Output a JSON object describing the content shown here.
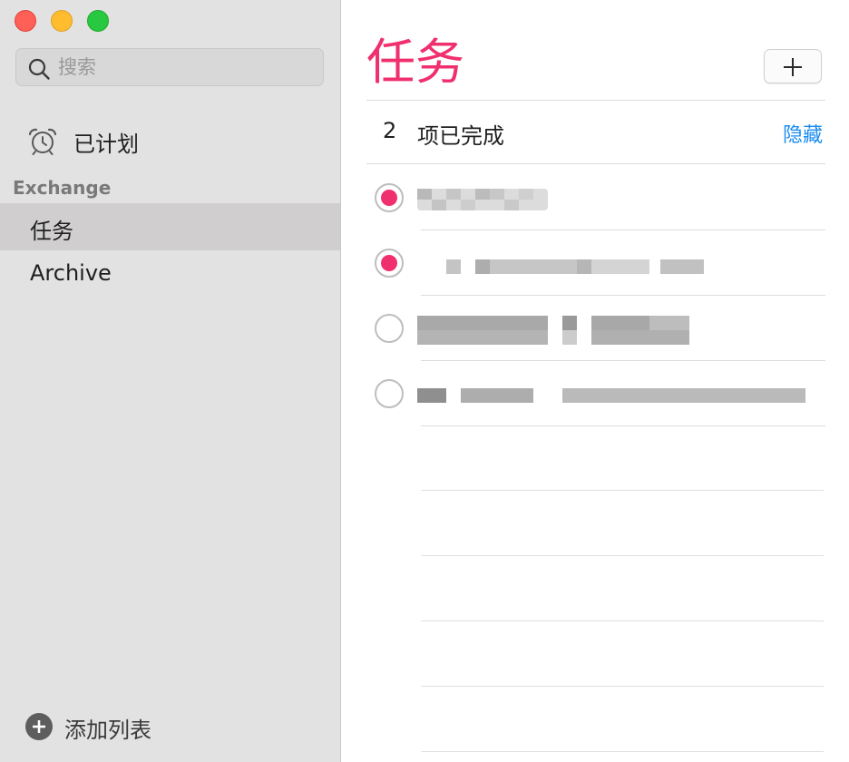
{
  "sidebar": {
    "search_placeholder": "搜索",
    "scheduled_label": "已计划",
    "section_header": "Exchange",
    "lists": [
      {
        "label": "任务"
      },
      {
        "label": "Archive"
      }
    ],
    "add_list_label": "添加列表"
  },
  "main": {
    "title": "任务",
    "completed_count": "2",
    "completed_text": "项已完成",
    "hide_label": "隐藏",
    "tasks": [
      {
        "completed": true
      },
      {
        "completed": true
      },
      {
        "completed": false
      },
      {
        "completed": false
      }
    ]
  },
  "colors": {
    "accent": "#f0306e",
    "link": "#1a8cf0",
    "sidebar_bg": "#e3e2e3",
    "selected_bg": "#d0cecf"
  },
  "icons": {
    "window_controls": [
      "close-icon",
      "minimize-icon",
      "zoom-icon"
    ],
    "search": "search-icon",
    "scheduled": "alarm-clock-icon",
    "add_reminder": "plus-icon",
    "add_list": "plus-circle-icon"
  }
}
